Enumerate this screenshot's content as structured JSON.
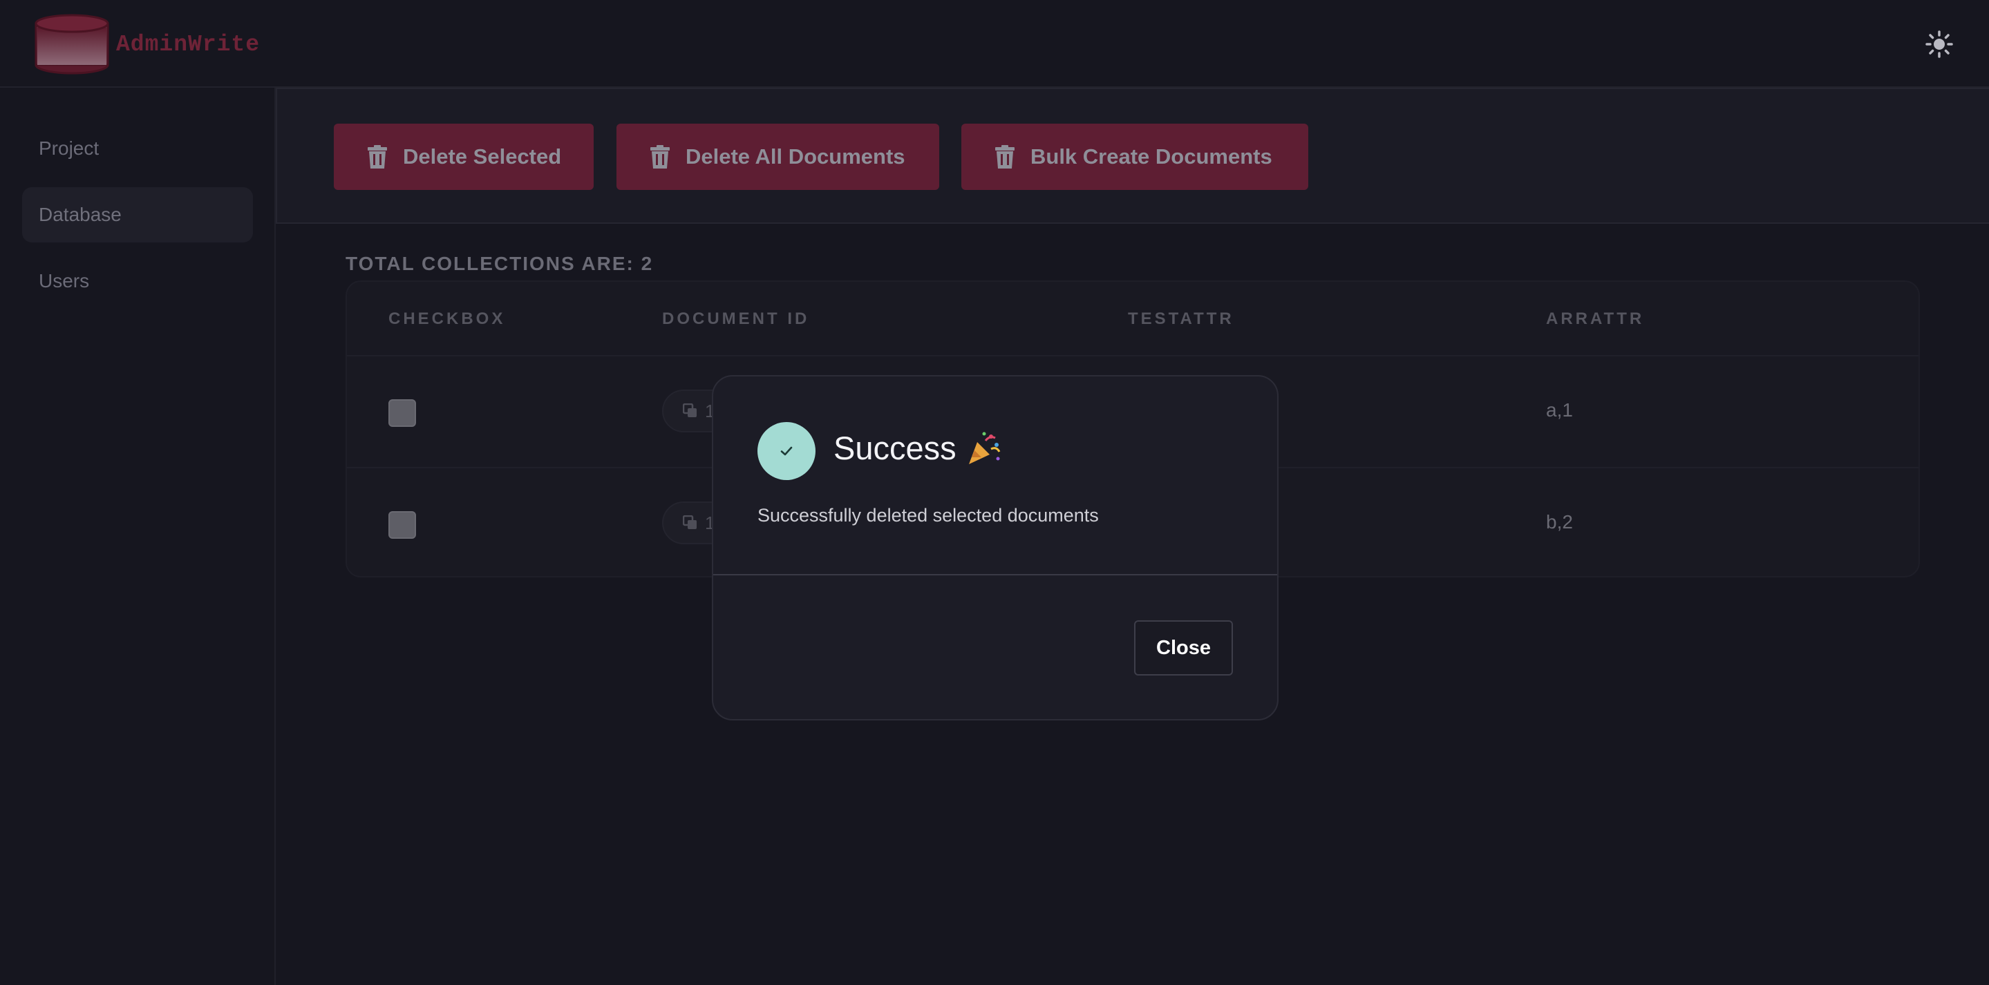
{
  "app": {
    "name": "AdminWrite"
  },
  "header": {
    "theme_icon": "sun-icon"
  },
  "sidebar": {
    "items": [
      {
        "label": "Project"
      },
      {
        "label": "Database"
      },
      {
        "label": "Users"
      }
    ]
  },
  "toolbar": {
    "buttons": [
      {
        "label": "Delete Selected",
        "icon": "trash-icon"
      },
      {
        "label": "Delete All Documents",
        "icon": "trash-icon"
      },
      {
        "label": "Bulk Create Documents",
        "icon": "trash-icon"
      }
    ]
  },
  "main": {
    "total_label": "TOTAL COLLECTIONS ARE: 2",
    "table": {
      "headers": [
        "CHECKBOX",
        "DOCUMENT ID",
        "TESTATTR",
        "ARRATTR"
      ],
      "rows": [
        {
          "doc_id": "1",
          "testattr": "",
          "arrattr": "a,1"
        },
        {
          "doc_id": "1",
          "testattr": "",
          "arrattr": "b,2"
        }
      ]
    }
  },
  "modal": {
    "title": "Success",
    "title_emoji_icon": "party-popper-icon",
    "message": "Successfully deleted selected documents",
    "close_label": "Close"
  },
  "colors": {
    "accent": "#5e1e33",
    "success": "#a3dbd3",
    "background": "#16161f"
  }
}
